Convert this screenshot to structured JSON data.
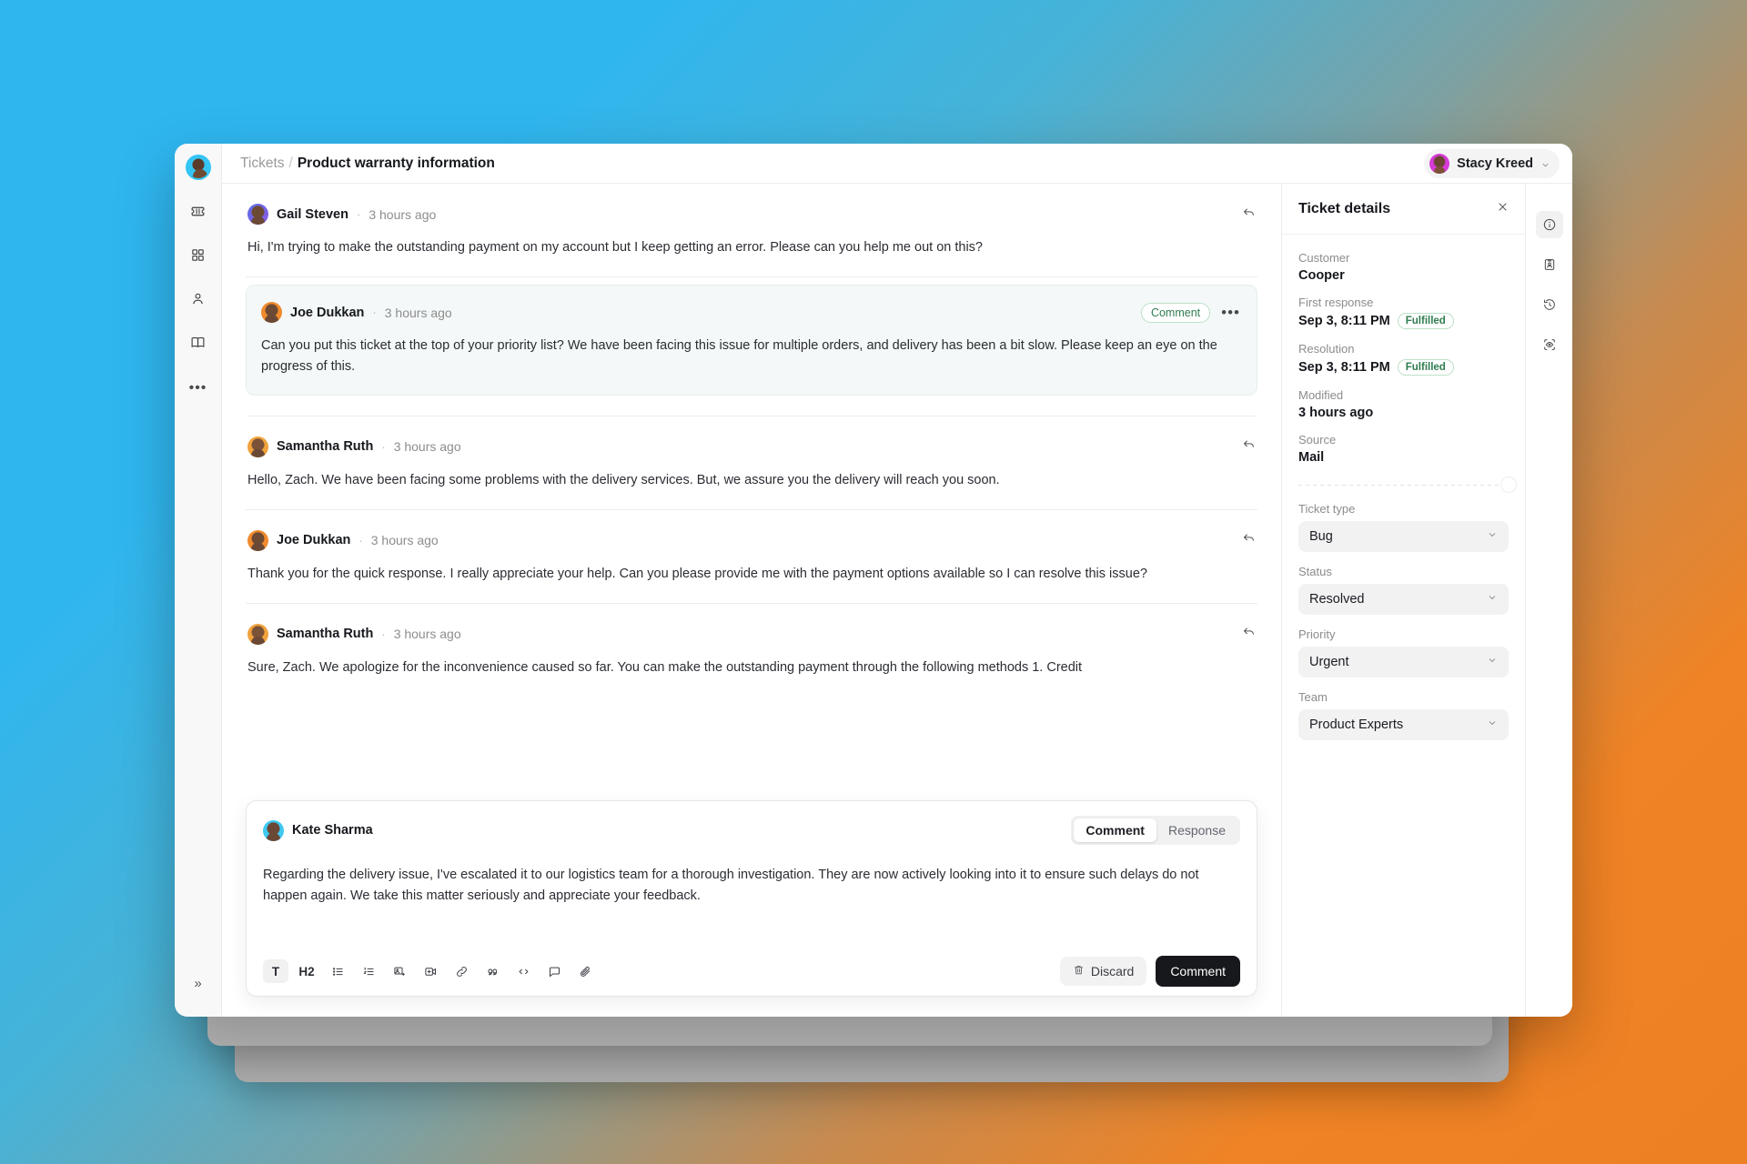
{
  "sidebar": {
    "avatar_name": "user-avatar",
    "items": [
      {
        "icon": "ticket-icon",
        "label": "Tickets"
      },
      {
        "icon": "grid-icon",
        "label": "Dashboard"
      },
      {
        "icon": "person-icon",
        "label": "Contacts"
      },
      {
        "icon": "book-icon",
        "label": "Knowledge base"
      },
      {
        "icon": "more-icon",
        "label": "More"
      }
    ],
    "collapse_label": "»"
  },
  "topbar": {
    "breadcrumb_root": "Tickets",
    "breadcrumb_sep": "/",
    "breadcrumb_current": "Product warranty information",
    "user_name": "Stacy Kreed",
    "user_chevron": "chevron-down-icon"
  },
  "thread": {
    "messages": [
      {
        "author": "Gail Steven",
        "time": "3 hours ago",
        "body": "Hi, I'm trying to make the outstanding payment on my account but I keep getting an error. Please can you help me out on this?",
        "action": "reply",
        "avatar": "av-gail",
        "highlight": false
      },
      {
        "author": "Joe Dukkan",
        "time": "3 hours ago",
        "body": "Can you put this ticket at the top of your priority list? We have been facing this issue for multiple orders, and delivery has been a bit slow. Please keep an eye on the progress of this.",
        "action": "comment-badge",
        "badge": "Comment",
        "avatar": "av-joe",
        "highlight": true
      },
      {
        "author": "Samantha Ruth",
        "time": "3 hours ago",
        "body": "Hello, Zach. We have been facing some problems with the delivery services. But, we assure you the delivery will reach you soon.",
        "action": "reply",
        "avatar": "av-sam",
        "highlight": false
      },
      {
        "author": "Joe Dukkan",
        "time": "3 hours ago",
        "body": "Thank you for the quick response. I really appreciate your help. Can you please provide me with the payment options available so I can resolve this issue?",
        "action": "reply",
        "avatar": "av-joe",
        "highlight": false
      },
      {
        "author": "Samantha Ruth",
        "time": "3 hours ago",
        "body": "Sure, Zach. We apologize for the inconvenience caused so far. You can make the outstanding payment through the following methods 1. Credit",
        "action": "reply",
        "avatar": "av-sam",
        "highlight": false
      }
    ]
  },
  "composer": {
    "author": "Kate Sharma",
    "tabs": [
      {
        "label": "Comment",
        "active": true
      },
      {
        "label": "Response",
        "active": false
      }
    ],
    "text": "Regarding the delivery issue, I've escalated it to our logistics team for a thorough investigation. They are now actively looking into it to ensure such delays do not happen again. We take this matter seriously and appreciate your feedback.",
    "tools": [
      {
        "name": "text-format-icon",
        "glyph": "T",
        "active": true
      },
      {
        "name": "heading-2-icon",
        "glyph": "H2",
        "active": false
      },
      {
        "name": "bullet-list-icon",
        "glyph": "",
        "active": false
      },
      {
        "name": "numbered-list-icon",
        "glyph": "",
        "active": false
      },
      {
        "name": "insert-image-icon",
        "glyph": "",
        "active": false
      },
      {
        "name": "insert-video-icon",
        "glyph": "",
        "active": false
      },
      {
        "name": "link-icon",
        "glyph": "",
        "active": false
      },
      {
        "name": "quote-icon",
        "glyph": "",
        "active": false
      },
      {
        "name": "code-icon",
        "glyph": "",
        "active": false
      },
      {
        "name": "comment-bubble-icon",
        "glyph": "",
        "active": false
      },
      {
        "name": "attachment-icon",
        "glyph": "",
        "active": false
      }
    ],
    "discard_label": "Discard",
    "submit_label": "Comment"
  },
  "details": {
    "title": "Ticket details",
    "close_icon": "close-icon",
    "fields": [
      {
        "label": "Customer",
        "value": "Cooper",
        "badge": null
      },
      {
        "label": "First response",
        "value": "Sep 3, 8:11 PM",
        "badge": "Fulfilled"
      },
      {
        "label": "Resolution",
        "value": "Sep 3, 8:11 PM",
        "badge": "Fulfilled"
      },
      {
        "label": "Modified",
        "value": "3 hours ago",
        "badge": null
      },
      {
        "label": "Source",
        "value": "Mail",
        "badge": null
      }
    ],
    "selects": [
      {
        "label": "Ticket type",
        "value": "Bug"
      },
      {
        "label": "Status",
        "value": "Resolved"
      },
      {
        "label": "Priority",
        "value": "Urgent"
      },
      {
        "label": "Team",
        "value": "Product Experts"
      }
    ]
  },
  "right_rail": {
    "items": [
      {
        "icon": "info-icon",
        "active": true
      },
      {
        "icon": "contact-card-icon",
        "active": false
      },
      {
        "icon": "history-icon",
        "active": false
      },
      {
        "icon": "activity-view-icon",
        "active": false
      }
    ]
  },
  "colors": {
    "accent_blue": "#2fb6ef",
    "accent_orange": "#ef8325",
    "success_green": "#2f7d4f",
    "dark_button": "#17181c"
  }
}
